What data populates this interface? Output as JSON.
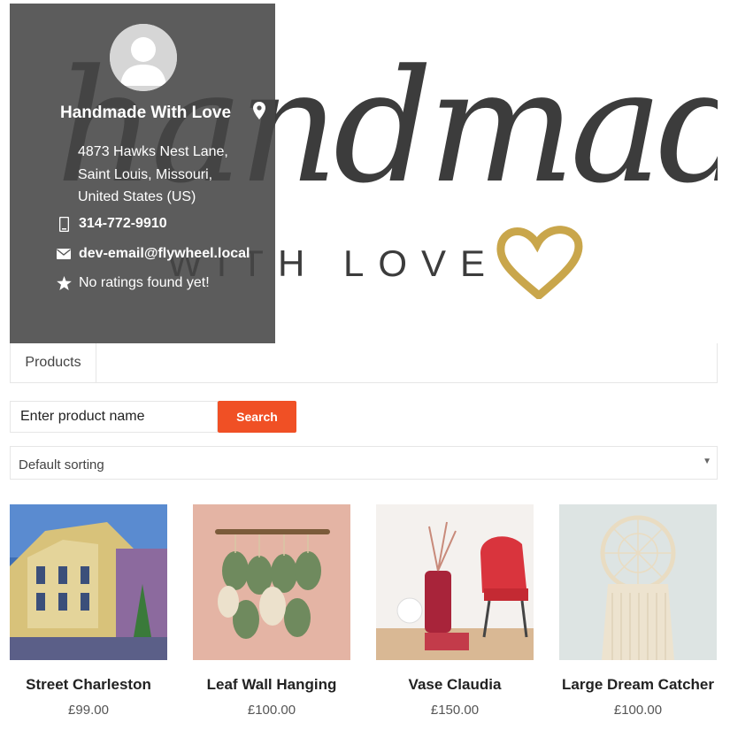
{
  "banner": {
    "script_text": "handmade",
    "sub_text": "WITH LOVE",
    "heart_color": "#c9a64b"
  },
  "store": {
    "name": "Handmade With Love",
    "address_line1": "4873 Hawks Nest Lane,",
    "address_line2": "Saint Louis, Missouri,",
    "address_line3": "United States (US)",
    "phone": "314-772-9910",
    "email": "dev-email@flywheel.local",
    "rating": "No ratings found yet!",
    "card_bg": "#555555"
  },
  "tabs": [
    {
      "label": "Products"
    }
  ],
  "search": {
    "placeholder": "Enter product name",
    "button_label": "Search",
    "button_color": "#f05025"
  },
  "sorting": {
    "selected": "Default sorting"
  },
  "products": [
    {
      "title": "Street Charleston",
      "price": "£99.00"
    },
    {
      "title": "Leaf Wall Hanging",
      "price": "£100.00"
    },
    {
      "title": "Vase Claudia",
      "price": "£150.00"
    },
    {
      "title": "Large Dream Catcher",
      "price": "£100.00"
    }
  ]
}
